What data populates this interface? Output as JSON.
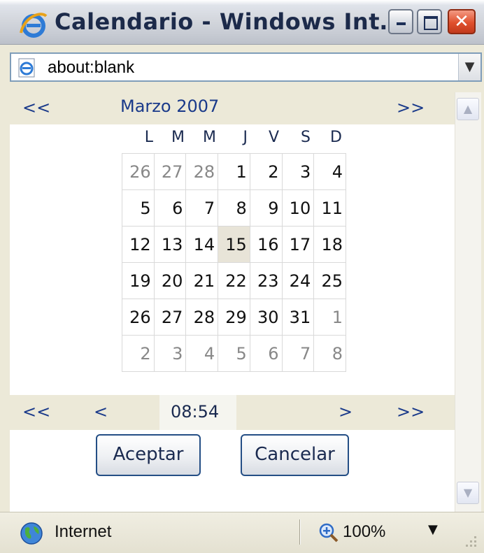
{
  "window": {
    "title": "Calendario - Windows Int…"
  },
  "address": {
    "url": "about:blank"
  },
  "calendar": {
    "prev_year": "<<",
    "month_label": "Marzo 2007",
    "next_year": ">>",
    "weekdays": [
      "L",
      "M",
      "M",
      "J",
      "V",
      "S",
      "D"
    ],
    "weeks": [
      [
        {
          "d": "26",
          "other": true
        },
        {
          "d": "27",
          "other": true
        },
        {
          "d": "28",
          "other": true
        },
        {
          "d": "1"
        },
        {
          "d": "2"
        },
        {
          "d": "3"
        },
        {
          "d": "4"
        }
      ],
      [
        {
          "d": "5"
        },
        {
          "d": "6"
        },
        {
          "d": "7"
        },
        {
          "d": "8"
        },
        {
          "d": "9"
        },
        {
          "d": "10"
        },
        {
          "d": "11"
        }
      ],
      [
        {
          "d": "12"
        },
        {
          "d": "13"
        },
        {
          "d": "14"
        },
        {
          "d": "15",
          "selected": true
        },
        {
          "d": "16"
        },
        {
          "d": "17"
        },
        {
          "d": "18"
        }
      ],
      [
        {
          "d": "19"
        },
        {
          "d": "20"
        },
        {
          "d": "21"
        },
        {
          "d": "22"
        },
        {
          "d": "23"
        },
        {
          "d": "24"
        },
        {
          "d": "25"
        }
      ],
      [
        {
          "d": "26"
        },
        {
          "d": "27"
        },
        {
          "d": "28"
        },
        {
          "d": "29"
        },
        {
          "d": "30"
        },
        {
          "d": "31"
        },
        {
          "d": "1",
          "other": true
        }
      ],
      [
        {
          "d": "2",
          "other": true
        },
        {
          "d": "3",
          "other": true
        },
        {
          "d": "4",
          "other": true
        },
        {
          "d": "5",
          "other": true
        },
        {
          "d": "6",
          "other": true
        },
        {
          "d": "7",
          "other": true
        },
        {
          "d": "8",
          "other": true
        }
      ]
    ]
  },
  "time_nav": {
    "prev_hour": "<<",
    "prev_minute": "<",
    "time": "08:54",
    "next_minute": ">",
    "next_hour": ">>"
  },
  "buttons": {
    "ok": "Aceptar",
    "cancel": "Cancelar"
  },
  "status": {
    "zone": "Internet",
    "zoom": "100%"
  },
  "colors": {
    "nav_bg": "#ECE9D8",
    "link": "#1a3a8a",
    "selected_day_bg": "#e8e4d8"
  }
}
